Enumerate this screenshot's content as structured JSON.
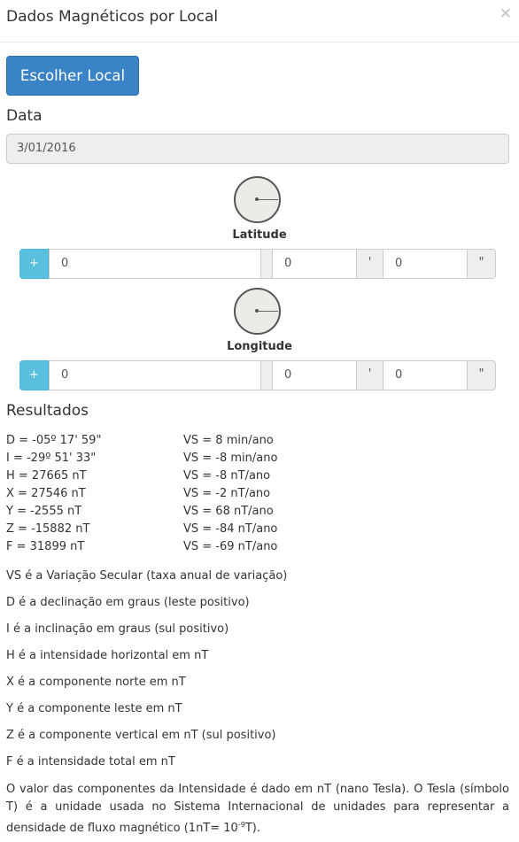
{
  "header": {
    "title": "Dados Magnéticos por Local",
    "close_label": "×"
  },
  "choose_button": {
    "label": "Escolher Local"
  },
  "date": {
    "label": "Data",
    "value": "3/01/2016"
  },
  "latitude": {
    "label": "Latitude",
    "sign": "+",
    "degrees": "0",
    "degrees_symbol": "º",
    "minutes": "0",
    "minutes_symbol": "'",
    "seconds": "0",
    "seconds_symbol": "\""
  },
  "longitude": {
    "label": "Longitude",
    "sign": "+",
    "degrees": "0",
    "degrees_symbol": "º",
    "minutes": "0",
    "minutes_symbol": "'",
    "seconds": "0",
    "seconds_symbol": "\""
  },
  "results": {
    "title": "Resultados",
    "values": [
      "D = -05º 17' 59\"",
      "I = -29º 51' 33\"",
      "H = 27665 nT",
      "X = 27546 nT",
      "Y = -2555 nT",
      "Z = -15882 nT",
      "F = 31899 nT"
    ],
    "variations": [
      "VS = 8 min/ano",
      "VS = -8 min/ano",
      "VS = -8 nT/ano",
      "VS = -2 nT/ano",
      "VS = 68 nT/ano",
      "VS = -84 nT/ano",
      "VS = -69 nT/ano"
    ]
  },
  "notes": [
    "VS é a Variação Secular (taxa anual de variação)",
    "D é a declinação em graus (leste positivo)",
    "I é a inclinação em graus (sul positivo)",
    "H é a intensidade horizontal em nT",
    "X é a componente norte em nT",
    "Y é a componente leste em nT",
    "Z é a componente vertical em nT (sul positivo)",
    "F é a intensidade total em nT"
  ],
  "footer": {
    "text_main": "O valor das componentes da Intensidade é dado em nT (nano Tesla). O Tesla (símbolo T) é a unidade usada no Sistema Internacional de unidades para representar a densidade de fluxo magnético (1nT= 10",
    "exponent": "-9",
    "text_end": "T)."
  }
}
